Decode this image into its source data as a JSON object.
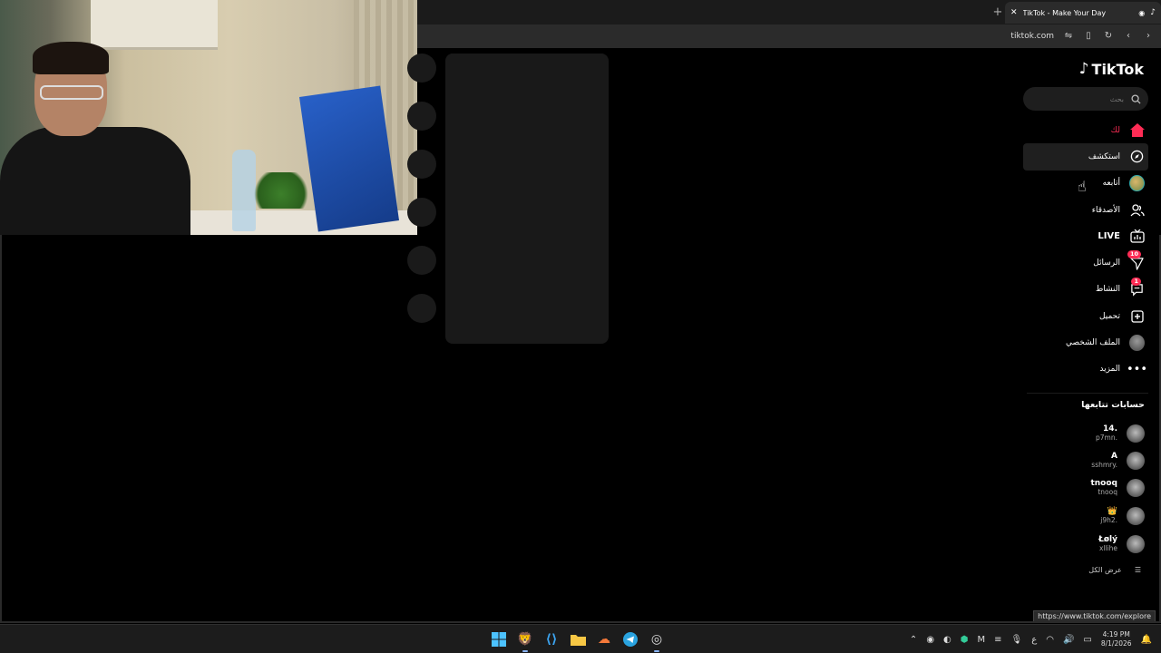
{
  "browser": {
    "tab_title": "TikTok - Make Your Day",
    "url": "tiktok.com",
    "status_url": "https://www.tiktok.com/explore"
  },
  "tiktok": {
    "logo_text": "TikTok",
    "search_placeholder": "بحث",
    "nav": [
      {
        "id": "home",
        "label": "لك",
        "icon": "home-icon"
      },
      {
        "id": "explore",
        "label": "استكشف",
        "icon": "compass-icon"
      },
      {
        "id": "following",
        "label": "أتابعه",
        "icon": "avatar-icon"
      },
      {
        "id": "friends",
        "label": "الأصدقاء",
        "icon": "friends-icon"
      },
      {
        "id": "live",
        "label": "LIVE",
        "icon": "live-icon"
      },
      {
        "id": "messages",
        "label": "الرسائل",
        "icon": "send-icon",
        "badge": "10"
      },
      {
        "id": "activity",
        "label": "النشاط",
        "icon": "comment-icon",
        "badge": "1"
      },
      {
        "id": "upload",
        "label": "تحميل",
        "icon": "plus-box-icon"
      },
      {
        "id": "profile",
        "label": "الملف الشخصي",
        "icon": "profile-avatar-icon"
      },
      {
        "id": "more",
        "label": "المزيد",
        "icon": "more-icon"
      }
    ],
    "following_title": "حسابات تتابعها",
    "accounts": [
      {
        "name": "14.",
        "handle": "p7mn."
      },
      {
        "name": "A",
        "handle": "sshmry."
      },
      {
        "name": "tnooq",
        "handle": "tnooq"
      },
      {
        "name": "👑",
        "handle": "j9h2."
      },
      {
        "name": "Łølý",
        "handle": "xllihe"
      }
    ],
    "see_all": "عرض الكل"
  },
  "taskbar": {
    "time": "4:19 PM",
    "date": "8/1/2026",
    "lang": "ع"
  }
}
